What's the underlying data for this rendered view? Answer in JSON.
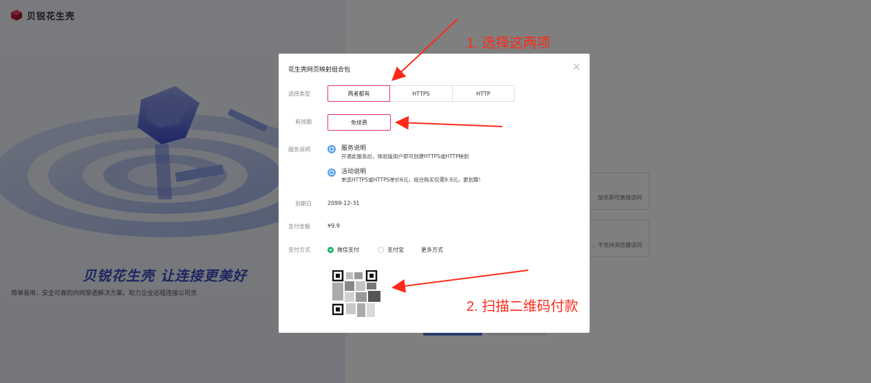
{
  "brand": {
    "name": "贝锐花生壳",
    "accent": "#c8193c"
  },
  "hero": {
    "slogan": "贝锐花生壳 让连接更美好",
    "subtitle": "简单易用、安全可靠的内网穿透解决方案，助力企业远程连接公司资"
  },
  "background": {
    "card1_text": "加名即可直接访问",
    "card2_text": "，不支持浏览器访问"
  },
  "modal": {
    "title": "花生壳网页映射组合包",
    "close_icon": "close-icon",
    "type": {
      "label": "选择类型",
      "options": [
        "两者都有",
        "HTTPS",
        "HTTP"
      ],
      "selected": "两者都有"
    },
    "validity": {
      "label": "有效期",
      "value": "免续费"
    },
    "service": {
      "label": "服务说明",
      "items": [
        {
          "title": "服务说明",
          "desc": "开通此服务后，体验版用户即可创建HTTPS或HTTP映射"
        },
        {
          "title": "活动说明",
          "desc": "单选HTTPS或HTTPS单价6元，组合购买仅需9.9元，更划算!"
        }
      ]
    },
    "expiry": {
      "label": "到期日",
      "value": "2099-12-31"
    },
    "amount": {
      "label": "支付金额",
      "value": "¥9.9"
    },
    "payment": {
      "label": "支付方式",
      "options": [
        "微信支付",
        "支付宝",
        "更多方式"
      ],
      "selected": "微信支付",
      "selected_color": "#18b566"
    }
  },
  "annotations": {
    "step1": "1. 选择这两项",
    "step2": "2. 扫描二维码付款",
    "color": "#ff2a1a"
  }
}
